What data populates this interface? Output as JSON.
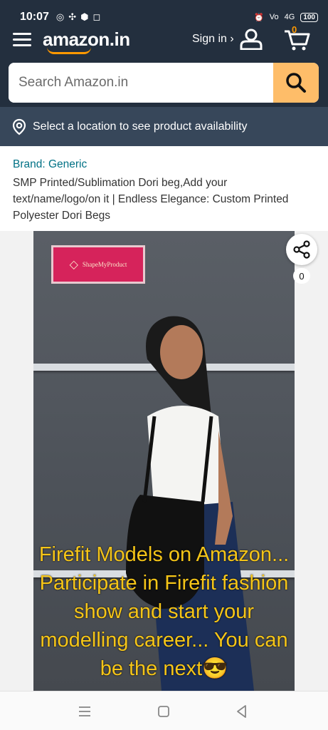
{
  "status": {
    "time": "10:07",
    "battery": "100",
    "network": "4G"
  },
  "header": {
    "logo_text": "amazon.in",
    "signin_label": "Sign in ›",
    "cart_count": "0"
  },
  "search": {
    "placeholder": "Search Amazon.in"
  },
  "location": {
    "text": "Select a location to see product availability"
  },
  "product": {
    "brand": "Brand: Generic",
    "title": "SMP Printed/Sublimation Dori beg,Add your text/name/logo/on it | Endless Elegance: Custom Printed Polyester Dori Begs",
    "image_sign_text": "ShapeMyProduct",
    "image_caption": "Firefit Models on Amazon... Participate in Firefit fashion show and start your modelling career... You can be the next😎",
    "share_count": "0"
  },
  "colors": {
    "header_bg": "#232f3e",
    "location_bg": "#37475a",
    "search_button": "#febd69",
    "brand_link": "#007185",
    "caption": "#f5c518"
  },
  "icons": [
    "menu-icon",
    "user-icon",
    "cart-icon",
    "search-icon",
    "location-pin-icon",
    "share-icon",
    "whatsapp-icon",
    "alarm-icon",
    "nav-menu-icon",
    "nav-home-icon",
    "nav-back-icon"
  ]
}
